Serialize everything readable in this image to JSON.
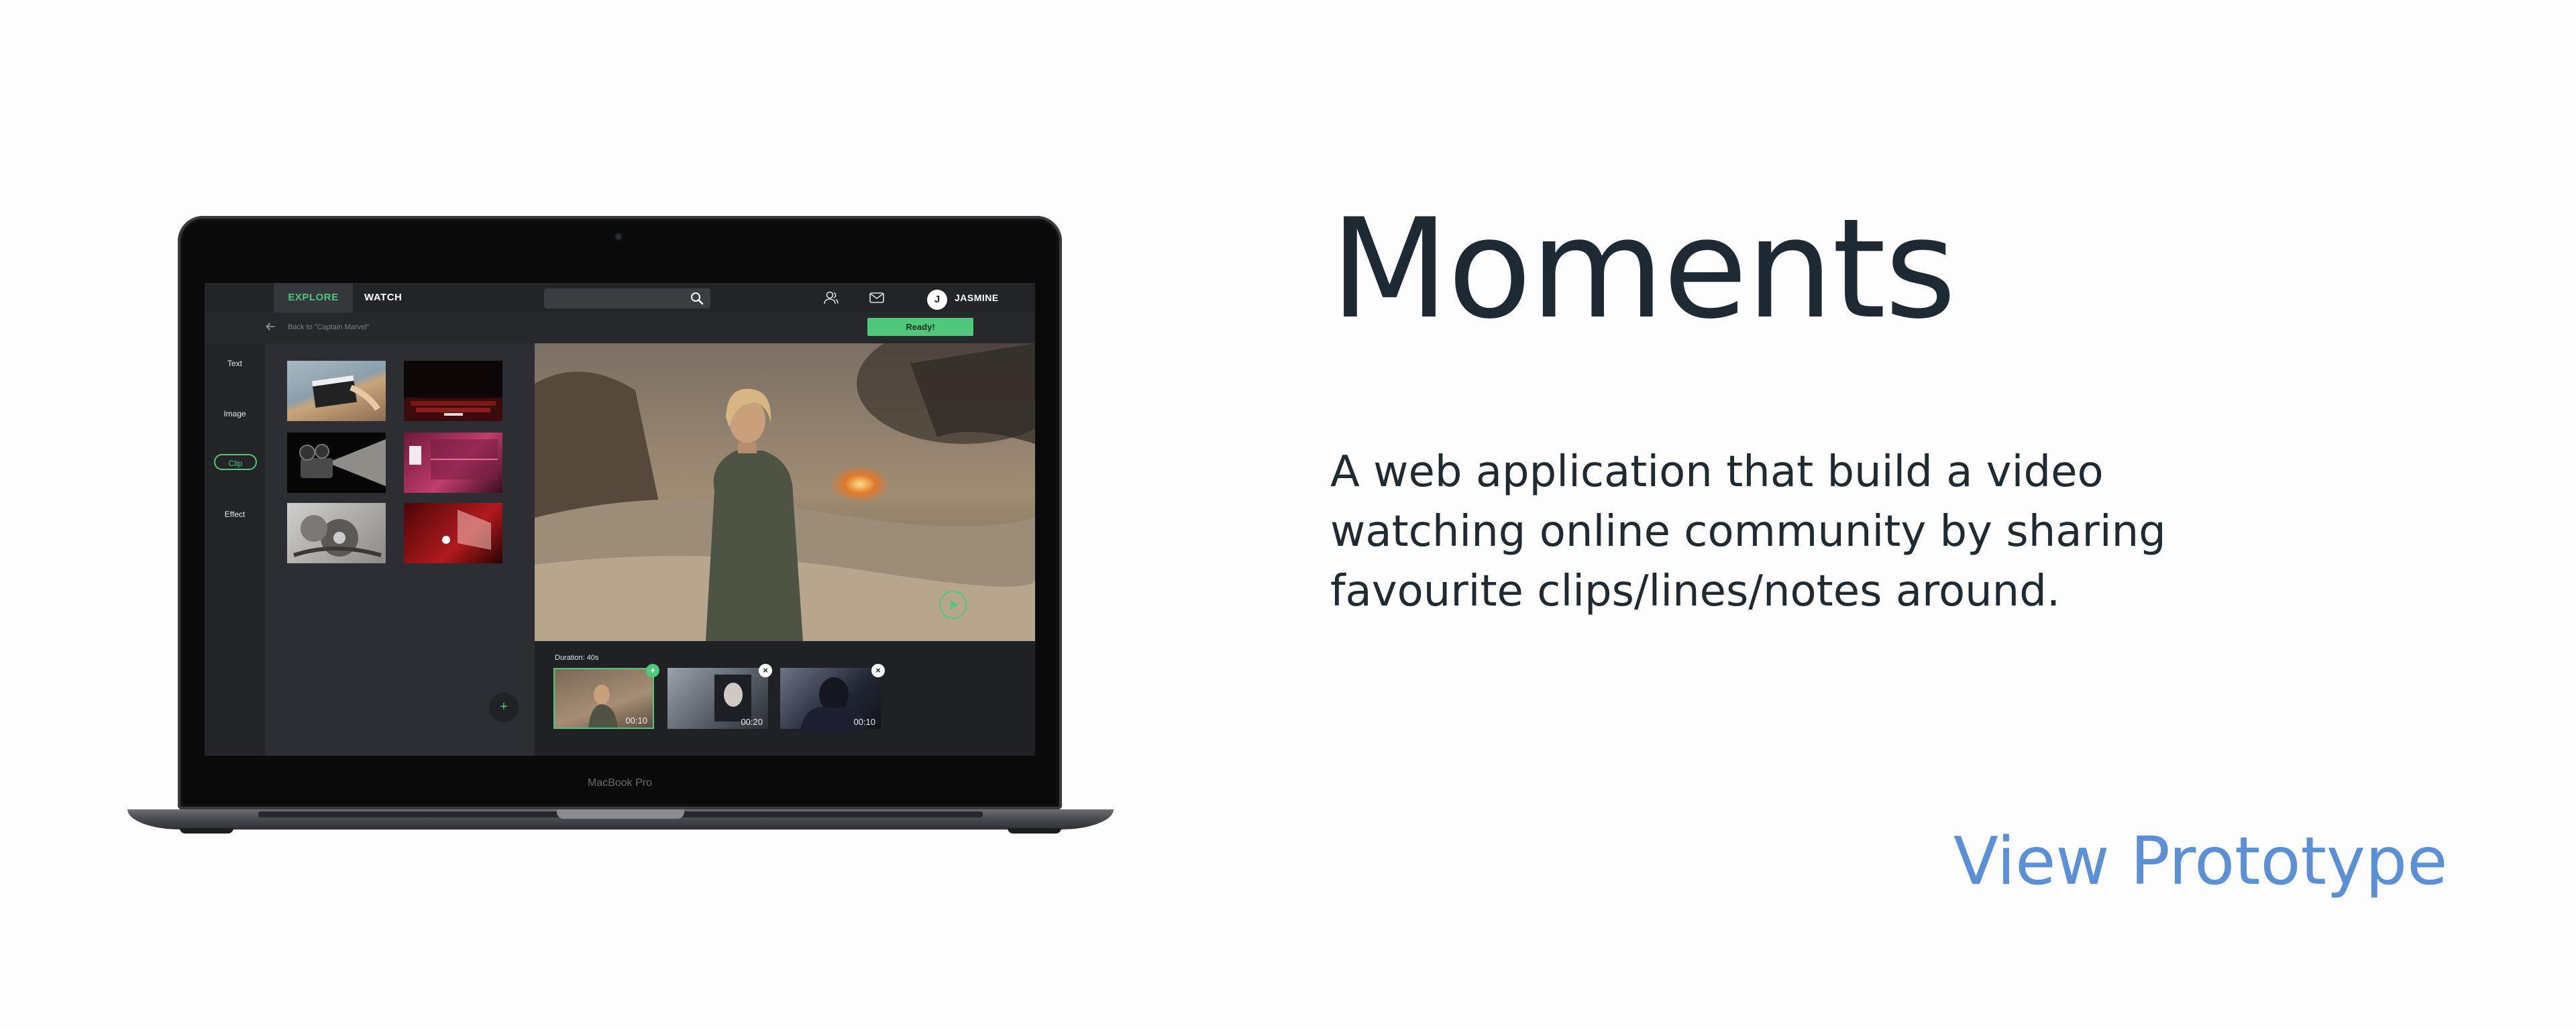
{
  "project": {
    "title": "Moments",
    "description": "A web application that build a video watching online community by sharing favourite clips/lines/notes around.",
    "cta_label": "View Prototype",
    "accent_color": "#5b8fd6",
    "title_color": "#1d2933"
  },
  "device": {
    "label": "MacBook Pro"
  },
  "app": {
    "accent_color": "#4fc87c",
    "topbar": {
      "tabs": [
        {
          "label": "EXPLORE",
          "active": true
        },
        {
          "label": "WATCH",
          "active": false
        }
      ],
      "search_icon": "search-icon",
      "icons": [
        "friends-icon",
        "mail-icon"
      ],
      "avatar_initial": "J",
      "username": "JASMINE"
    },
    "subbar": {
      "back_text": "Back to \"Captain Marvel\"",
      "ready_label": "Ready!"
    },
    "sidebar": {
      "items": [
        {
          "label": "Text"
        },
        {
          "label": "Image"
        },
        {
          "label": "Clip",
          "active": true
        },
        {
          "label": "Effect"
        }
      ]
    },
    "library": {
      "thumbnails": [
        "clapperboard",
        "cinema-seats",
        "film-projector",
        "pink-theater",
        "film-reels",
        "red-cinema"
      ],
      "add_label": "+"
    },
    "timeline": {
      "duration_label": "Duration: 40s",
      "clips": [
        {
          "time": "00:10",
          "badge": "+",
          "selected": true
        },
        {
          "time": "00:20",
          "badge": "×"
        },
        {
          "time": "00:10",
          "badge": "×"
        }
      ]
    }
  }
}
